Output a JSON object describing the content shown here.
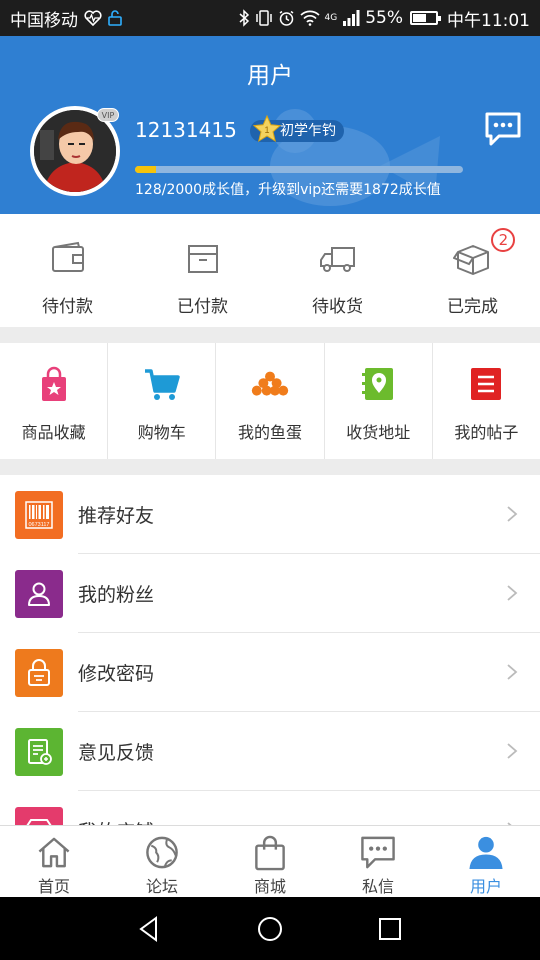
{
  "status_bar": {
    "carrier": "中国移动",
    "network": "4G",
    "battery": "55%",
    "battery_level": 0.55,
    "time": "中午11:01"
  },
  "header": {
    "title": "用户",
    "username": "12131415",
    "vip_badge": "VIP",
    "level_number": "1",
    "level_name": "初学乍钓",
    "growth_progress": 0.064,
    "growth_text": "128/2000成长值，升级到vip还需要1872成长值"
  },
  "orders": [
    {
      "label": "待付款",
      "icon": "wallet-icon"
    },
    {
      "label": "已付款",
      "icon": "box-icon"
    },
    {
      "label": "待收货",
      "icon": "truck-icon"
    },
    {
      "label": "已完成",
      "icon": "open-box-icon",
      "badge": "2"
    }
  ],
  "shortcuts": [
    {
      "label": "商品收藏",
      "icon": "shopping-bag-star-icon",
      "color": "#e8407a"
    },
    {
      "label": "购物车",
      "icon": "cart-icon",
      "color": "#1e9ad6"
    },
    {
      "label": "我的鱼蛋",
      "icon": "fish-eggs-icon",
      "color": "#f07c1b"
    },
    {
      "label": "收货地址",
      "icon": "location-book-icon",
      "color": "#6cbb2d"
    },
    {
      "label": "我的帖子",
      "icon": "posts-icon",
      "color": "#e02323"
    }
  ],
  "menu": [
    {
      "label": "推荐好友",
      "icon": "barcode-icon",
      "color": "#f26d22",
      "barcode_text": "0673117"
    },
    {
      "label": "我的粉丝",
      "icon": "person-icon",
      "color": "#8a2b8c"
    },
    {
      "label": "修改密码",
      "icon": "lock-icon",
      "color": "#ee7a1d"
    },
    {
      "label": "意见反馈",
      "icon": "feedback-icon",
      "color": "#5cb532"
    },
    {
      "label": "我的店铺",
      "icon": "store-icon",
      "color": "#e43b6c"
    }
  ],
  "tabs": [
    {
      "label": "首页",
      "icon": "home-icon",
      "active": false
    },
    {
      "label": "论坛",
      "icon": "globe-icon",
      "active": false
    },
    {
      "label": "商城",
      "icon": "shopping-bag-icon",
      "active": false
    },
    {
      "label": "私信",
      "icon": "chat-icon",
      "active": false
    },
    {
      "label": "用户",
      "icon": "user-icon",
      "active": true
    }
  ],
  "colors": {
    "header_bg": "#2f7fd2",
    "accent": "#3b8fe0",
    "progress": "#f5c30b"
  }
}
